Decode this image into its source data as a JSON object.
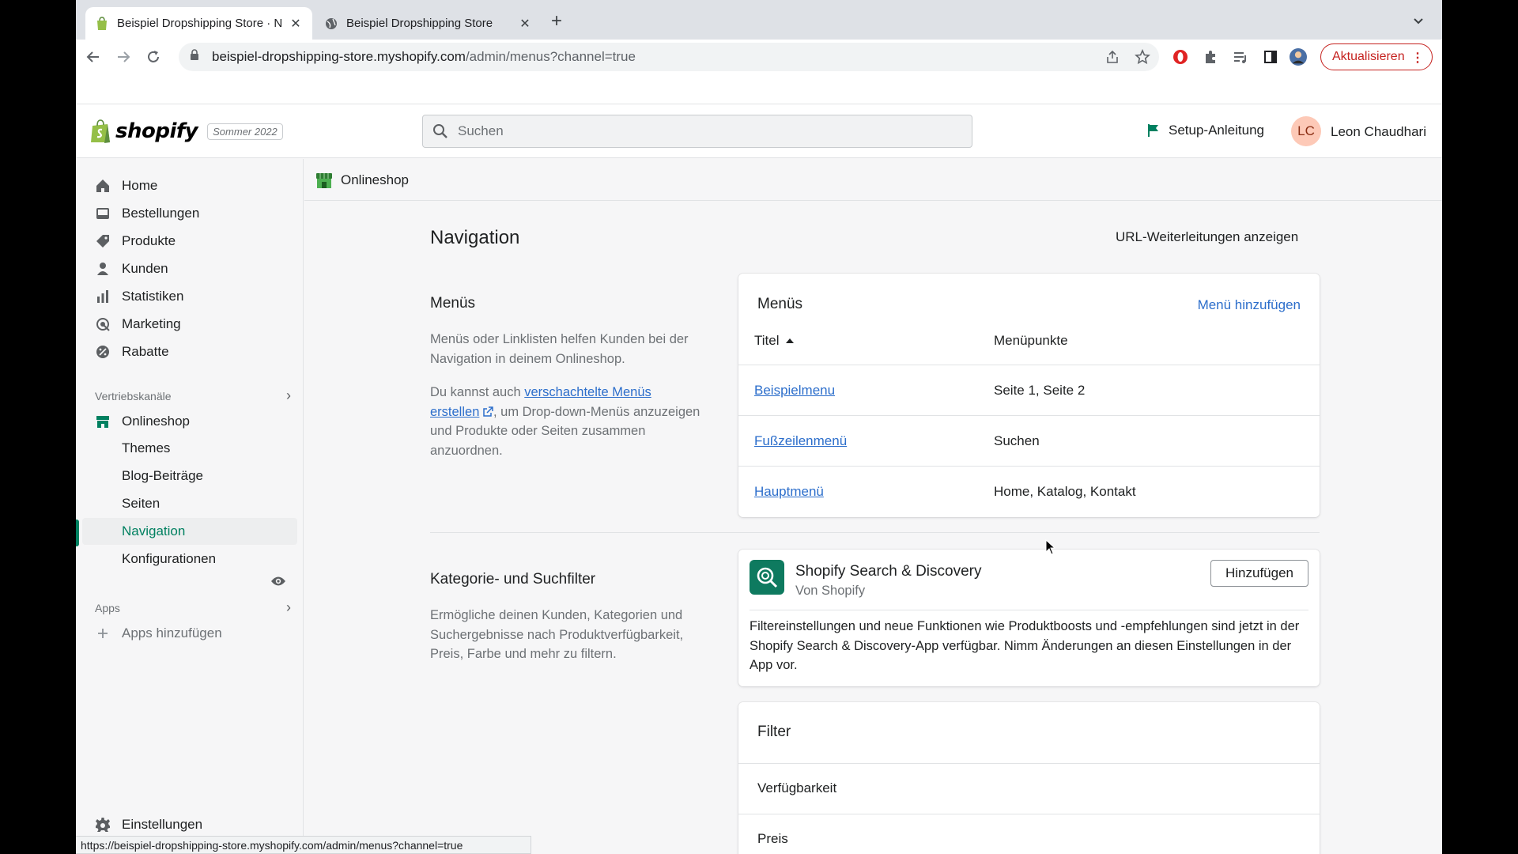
{
  "browser": {
    "tabs": [
      {
        "label": "Beispiel Dropshipping Store · N"
      },
      {
        "label": "Beispiel Dropshipping Store"
      }
    ],
    "url_host": "beispiel-dropshipping-store.myshopify.com",
    "url_path": "/admin/menus?channel=true",
    "update_label": "Aktualisieren",
    "status_url": "https://beispiel-dropshipping-store.myshopify.com/admin/menus?channel=true"
  },
  "topbar": {
    "logo_text": "shopify",
    "edition": "Sommer 2022",
    "search_placeholder": "Suchen",
    "setup_label": "Setup-Anleitung",
    "user_initials": "LC",
    "user_name": "Leon Chaudhari"
  },
  "sidebar": {
    "items": [
      {
        "label": "Home",
        "icon": "home-icon"
      },
      {
        "label": "Bestellungen",
        "icon": "orders-icon"
      },
      {
        "label": "Produkte",
        "icon": "tag-icon"
      },
      {
        "label": "Kunden",
        "icon": "person-icon"
      },
      {
        "label": "Statistiken",
        "icon": "bar-chart-icon"
      },
      {
        "label": "Marketing",
        "icon": "target-icon"
      },
      {
        "label": "Rabatte",
        "icon": "discount-icon"
      }
    ],
    "sales_channels_heading": "Vertriebskanäle",
    "online_store": "Onlineshop",
    "subitems": [
      {
        "label": "Themes"
      },
      {
        "label": "Blog-Beiträge"
      },
      {
        "label": "Seiten"
      },
      {
        "label": "Navigation"
      },
      {
        "label": "Konfigurationen"
      }
    ],
    "apps_heading": "Apps",
    "add_apps": "Apps hinzufügen",
    "settings": "Einstellungen"
  },
  "breadcrumb": {
    "title": "Onlineshop"
  },
  "page": {
    "title": "Navigation",
    "redirects_link": "URL-Weiterleitungen anzeigen",
    "menus_section": {
      "title": "Menüs",
      "desc1": "Menüs oder Linklisten helfen Kunden bei der Navigation in deinem Onlineshop.",
      "desc2_before": "Du kannst auch ",
      "desc2_link": "verschachtelte Menüs erstellen",
      "desc2_after": ", um Drop-down-Menüs anzuzeigen und Produkte oder Seiten zusammen anzuordnen."
    },
    "menus_card": {
      "title": "Menüs",
      "add_link": "Menü hinzufügen",
      "col_title": "Titel",
      "col_items": "Menüpunkte",
      "rows": [
        {
          "title": "Beispielmenu",
          "items": "Seite 1, Seite 2"
        },
        {
          "title": "Fußzeilenmenü",
          "items": "Suchen"
        },
        {
          "title": "Hauptmenü",
          "items": "Home, Katalog, Kontakt"
        }
      ]
    },
    "filter_section": {
      "title": "Kategorie- und Suchfilter",
      "desc": "Ermögliche deinen Kunden, Kategorien und Suchergebnisse nach Produktverfügbarkeit, Preis, Farbe und mehr zu filtern."
    },
    "app_card": {
      "name": "Shopify Search & Discovery",
      "by": "Von Shopify",
      "button": "Hinzufügen",
      "desc": "Filtereinstellungen und neue Funktionen wie Produktboosts und -empfehlungen sind jetzt in der Shopify Search & Discovery-App verfügbar. Nimm Änderungen an diesen Einstellungen in der App vor."
    },
    "filter_card": {
      "title": "Filter",
      "rows": [
        {
          "label": "Verfügbarkeit"
        },
        {
          "label": "Preis"
        }
      ]
    }
  },
  "colors": {
    "accent_green": "#008060",
    "link_blue": "#2c6ecb",
    "update_red": "#c5221f"
  }
}
